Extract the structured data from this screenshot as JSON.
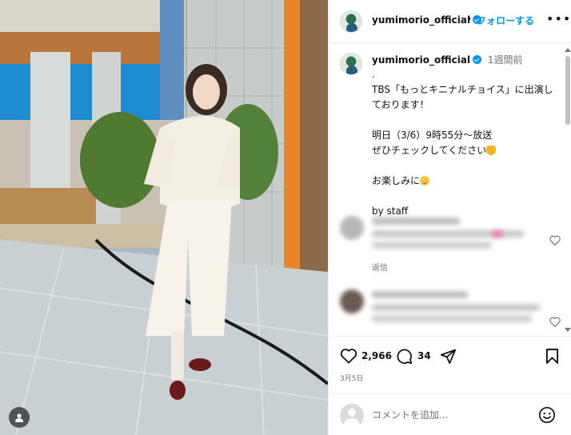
{
  "post": {
    "username": "yumimorio_official",
    "follow_dot": "•",
    "follow_label": "フォローする",
    "more_label": "•••"
  },
  "caption": {
    "username": "yumimorio_official",
    "time": "1週間前",
    "text": ".\nTBS「もっとキニナルチョイス」に出演しております！\n\n明日（3/6）9時55分～放送\nぜひチェックしてください",
    "line_fun": "お楽しみに",
    "by": "by staff",
    "emoji_pray": "pray-emoji",
    "emoji_smile": "smile-emoji"
  },
  "comments": [
    {
      "reply_label": "返信"
    },
    {
      "reply_label": ""
    }
  ],
  "actions": {
    "likes": "2,966",
    "comments": "34",
    "date": "3月5日"
  },
  "add_comment": {
    "placeholder": "コメントを追加..."
  },
  "icons": {
    "verified": "verified-badge-icon",
    "heart": "heart-icon",
    "comment": "comment-icon",
    "share": "share-icon",
    "save": "bookmark-icon",
    "emoji": "emoji-icon",
    "user": "user-icon"
  },
  "colors": {
    "accent": "#0095f6",
    "muted": "#737373",
    "border": "#efefef"
  }
}
